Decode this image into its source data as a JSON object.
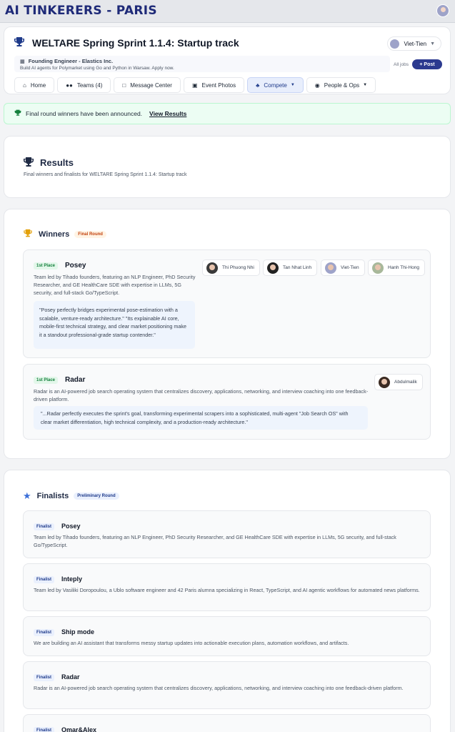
{
  "brand": "AI TINKERERS - PARIS",
  "event": {
    "title": "WELTARE Spring Sprint 1.1.4: Startup track",
    "user": "Viet-Tien"
  },
  "job": {
    "title": "Founding Engineer - Elastics Inc.",
    "description": "Build AI agents for Polymarket using Go and Python in Warsaw. Apply now.",
    "all_jobs": "All jobs",
    "post": "+ Post"
  },
  "tabs": [
    {
      "label": "Home",
      "icon": "home-icon"
    },
    {
      "label": "Teams (4)",
      "icon": "users-icon"
    },
    {
      "label": "Message Center",
      "icon": "chat-icon"
    },
    {
      "label": "Event Photos",
      "icon": "image-icon"
    },
    {
      "label": "Compete",
      "icon": "trophy-icon"
    },
    {
      "label": "People & Ops",
      "icon": "people-icon"
    }
  ],
  "alert": {
    "text": "Final round winners have been announced.",
    "link": "View Results"
  },
  "results": {
    "title": "Results",
    "subtitle": "Final winners and finalists for WELTARE Spring Sprint 1.1.4: Startup track"
  },
  "winners": {
    "title": "Winners",
    "badge": "Final Round",
    "items": [
      {
        "place": "1st Place",
        "name": "Posey",
        "description": "Team led by Tihado founders, featuring an NLP Engineer, PhD Security Researcher, and GE HealthCare SDE with expertise in LLMs, 5G security, and full-stack Go/TypeScript.",
        "quote": "\"Posey perfectly bridges experimental pose-estimation with a scalable, venture-ready architecture.\" \"Its explainable AI core, mobile-first technical strategy, and clear market positioning make it a standout professional-grade startup contender.\"",
        "members": [
          "Thi Phuong Nhi",
          "Tan Nhat Linh",
          "Viet-Tien",
          "Hanh Thi-Hong"
        ]
      },
      {
        "place": "1st Place",
        "name": "Radar",
        "description": "Radar is an AI-powered job search operating system that centralizes discovery, applications, networking, and interview coaching into one feedback-driven platform.",
        "quote": "\"...Radar perfectly executes the sprint's goal, transforming experimental scrapers into a sophisticated, multi-agent \"Job Search OS\" with clear market differentiation, high technical complexity, and a production-ready architecture.\"",
        "members": [
          "Abdulmalik"
        ]
      }
    ]
  },
  "finalists": {
    "title": "Finalists",
    "badge": "Preliminary Round",
    "label": "Finalist",
    "items": [
      {
        "name": "Posey",
        "description": "Team led by Tihado founders, featuring an NLP Engineer, PhD Security Researcher, and GE HealthCare SDE with expertise in LLMs, 5G security, and full-stack Go/TypeScript."
      },
      {
        "name": "Inteply",
        "description": "Team led by Vasiliki Doropoulou, a Ublo software engineer and 42 Paris alumna specializing in React, TypeScript, and AI agentic workflows for automated news platforms."
      },
      {
        "name": "Ship mode",
        "description": "We are building an AI assistant that transforms messy startup updates into actionable execution plans, automation workflows, and artifacts."
      },
      {
        "name": "Radar",
        "description": "Radar is an AI-powered job search operating system that centralizes discovery, applications, networking, and interview coaching into one feedback-driven platform."
      },
      {
        "name": "Omar&Alex",
        "description": ""
      }
    ]
  },
  "colors": {
    "brand": "#1e2a78",
    "accent": "#2c3a8f",
    "success_bg": "#ecfdf3",
    "winner_icon": "#e3a008",
    "finalist_icon": "#3b6fd8"
  }
}
